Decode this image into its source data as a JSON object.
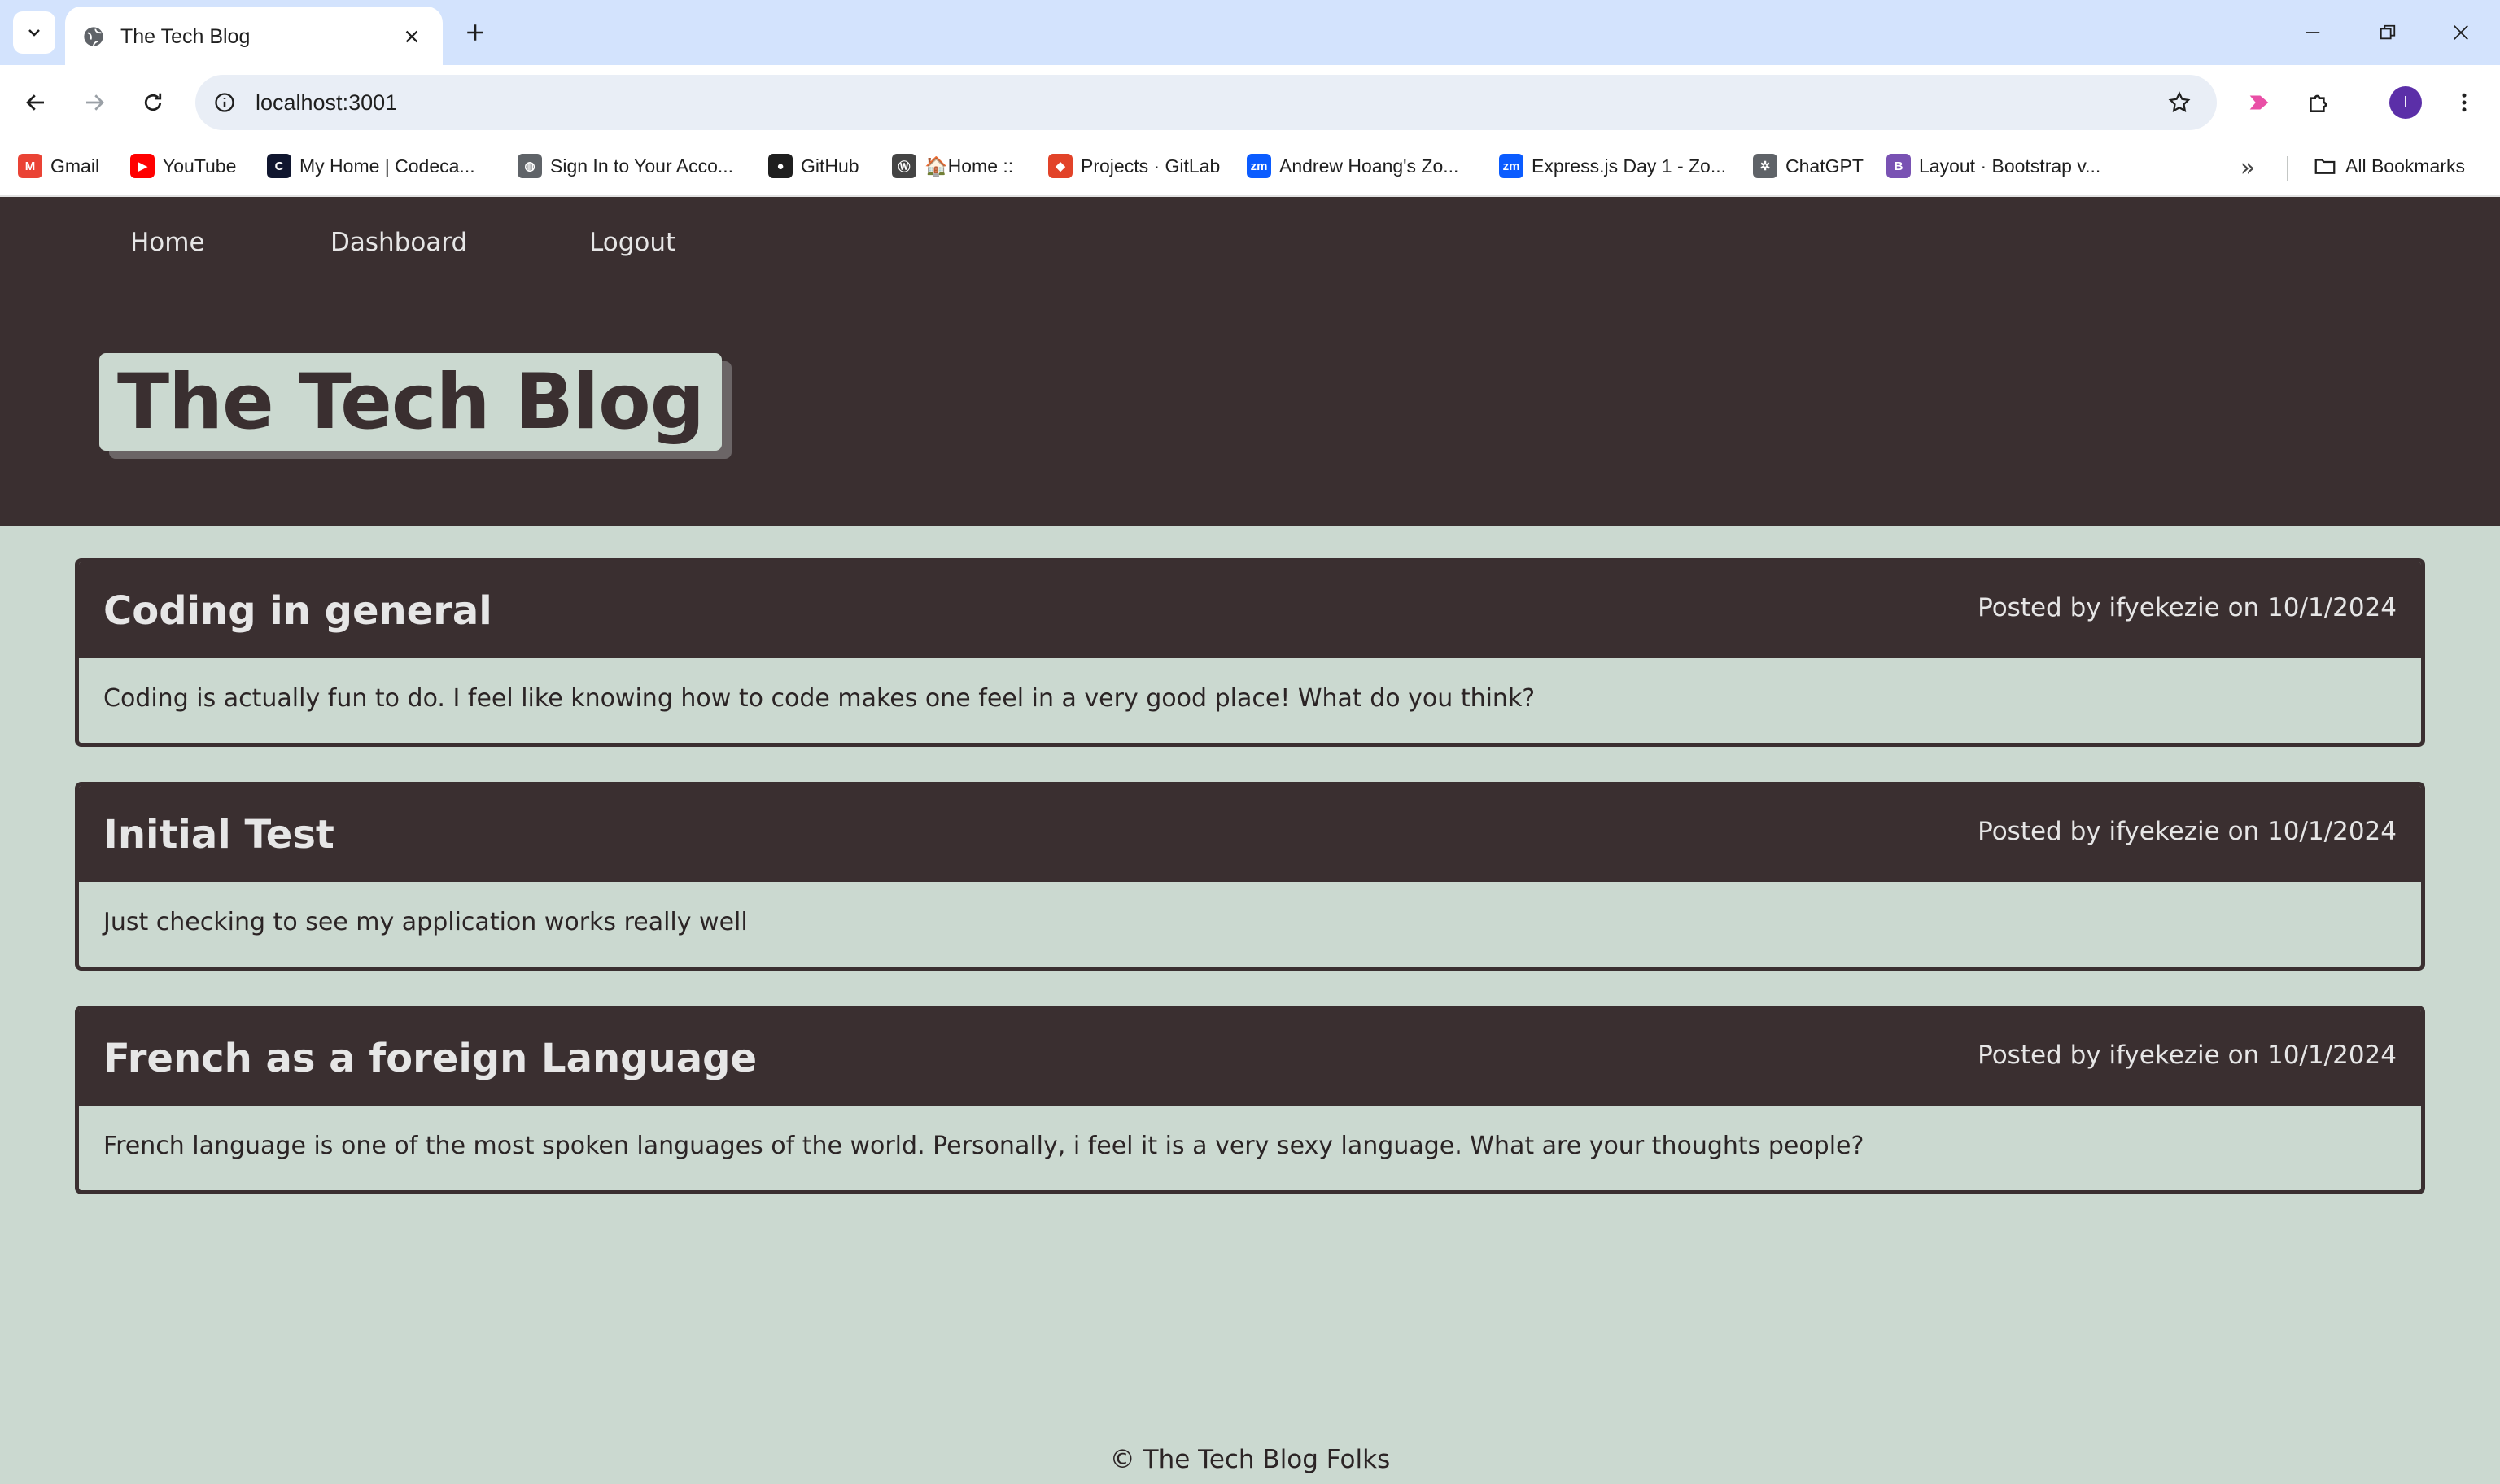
{
  "browser": {
    "tab_title": "The Tech Blog",
    "url": "localhost:3001",
    "profile_initial": "I",
    "bookmarks": [
      {
        "label": "Gmail",
        "icon": "gmail-icon",
        "color": "#ea4335",
        "glyph": "M"
      },
      {
        "label": "YouTube",
        "icon": "youtube-icon",
        "color": "#ff0000",
        "glyph": "▶"
      },
      {
        "label": "My Home | Codeca...",
        "icon": "codecademy-icon",
        "color": "#10162f",
        "glyph": "C"
      },
      {
        "label": "Sign In to Your Acco...",
        "icon": "globe-icon",
        "color": "#5f6368",
        "glyph": "◍"
      },
      {
        "label": "GitHub",
        "icon": "github-icon",
        "color": "#1f1f1f",
        "glyph": "●"
      },
      {
        "label": "🏠Home ::",
        "icon": "bootcamp-icon",
        "color": "#444444",
        "glyph": "Ⓦ"
      },
      {
        "label": "Projects · GitLab",
        "icon": "gitlab-icon",
        "color": "#e24329",
        "glyph": "◆"
      },
      {
        "label": "Andrew Hoang's Zo...",
        "icon": "zoom-icon",
        "color": "#0b5cff",
        "glyph": "zm"
      },
      {
        "label": "Express.js Day 1 - Zo...",
        "icon": "zoom-icon",
        "color": "#0b5cff",
        "glyph": "zm"
      },
      {
        "label": "ChatGPT",
        "icon": "chatgpt-icon",
        "color": "#5f6368",
        "glyph": "✲"
      },
      {
        "label": "Layout · Bootstrap v...",
        "icon": "bootstrap-icon",
        "color": "#7952b3",
        "glyph": "B"
      }
    ],
    "all_bookmarks_label": "All Bookmarks"
  },
  "nav": {
    "home": "Home",
    "dashboard": "Dashboard",
    "logout": "Logout"
  },
  "site": {
    "title": "The Tech Blog",
    "footer": "© The Tech Blog Folks"
  },
  "posts": [
    {
      "title": "Coding in general",
      "meta": "Posted by ifyekezie on 10/1/2024",
      "body": "Coding is actually fun to do. I feel like knowing how to code makes one feel in a very good place! What do you think?"
    },
    {
      "title": "Initial Test",
      "meta": "Posted by ifyekezie on 10/1/2024",
      "body": "Just checking to see my application works really well"
    },
    {
      "title": "French as a foreign Language",
      "meta": "Posted by ifyekezie on 10/1/2024",
      "body": "French language is one of the most spoken languages of the world. Personally, i feel it is a very sexy language. What are your thoughts people?"
    }
  ],
  "colors": {
    "header_bg": "#3a2f30",
    "page_bg": "#cbd9d0",
    "tabstrip_bg": "#d3e3fd"
  }
}
